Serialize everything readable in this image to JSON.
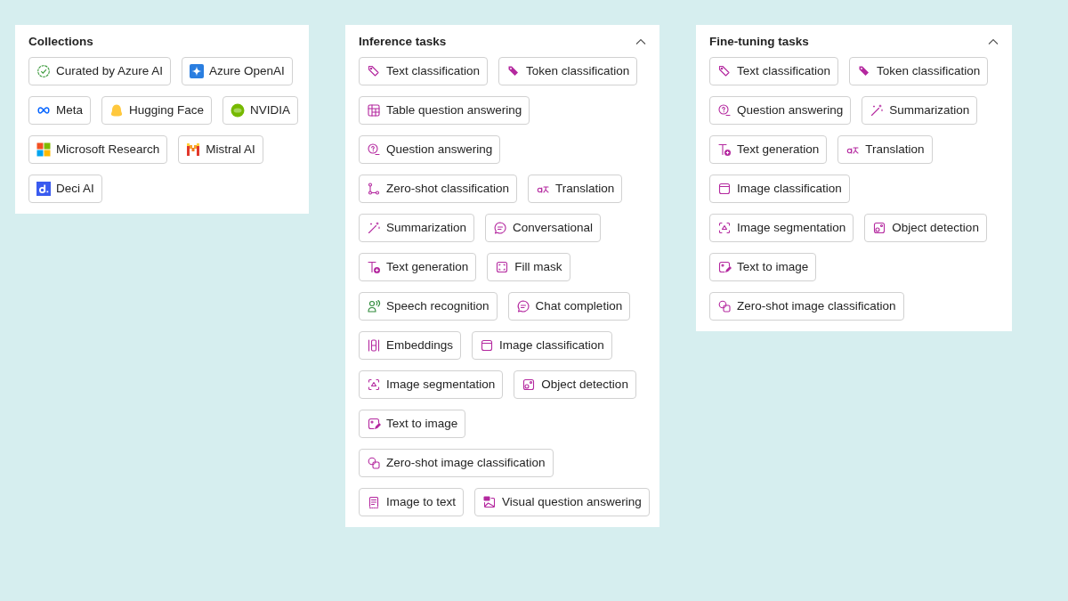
{
  "collections": {
    "title": "Collections",
    "rows": [
      [
        {
          "label": "Curated by Azure AI",
          "kind": "verified"
        },
        {
          "label": "Azure OpenAI",
          "kind": "azure-openai"
        }
      ],
      [
        {
          "label": "Meta",
          "kind": "meta"
        },
        {
          "label": "Hugging Face",
          "kind": "hugging-face"
        },
        {
          "label": "NVIDIA",
          "kind": "nvidia"
        }
      ],
      [
        {
          "label": "Microsoft Research",
          "kind": "microsoft"
        },
        {
          "label": "Mistral AI",
          "kind": "mistral"
        }
      ],
      [
        {
          "label": "Deci AI",
          "kind": "deci"
        }
      ]
    ]
  },
  "inference_tasks": {
    "title": "Inference tasks",
    "expanded": true,
    "rows": [
      [
        {
          "label": "Text classification",
          "kind": "tag"
        },
        {
          "label": "Token classification",
          "kind": "tag-filled"
        }
      ],
      [
        {
          "label": "Table question answering",
          "kind": "table"
        }
      ],
      [
        {
          "label": "Question answering",
          "kind": "question"
        }
      ],
      [
        {
          "label": "Zero-shot classification",
          "kind": "branch"
        },
        {
          "label": "Translation",
          "kind": "translate"
        }
      ],
      [
        {
          "label": "Summarization",
          "kind": "wand"
        },
        {
          "label": "Conversational",
          "kind": "chat"
        }
      ],
      [
        {
          "label": "Text generation",
          "kind": "text-plus"
        },
        {
          "label": "Fill mask",
          "kind": "frame"
        }
      ],
      [
        {
          "label": "Speech recognition",
          "kind": "voice"
        },
        {
          "label": "Chat completion",
          "kind": "chat"
        }
      ],
      [
        {
          "label": "Embeddings",
          "kind": "columns"
        },
        {
          "label": "Image classification",
          "kind": "image"
        }
      ],
      [
        {
          "label": "Image segmentation",
          "kind": "segment"
        },
        {
          "label": "Object detection",
          "kind": "detect"
        }
      ],
      [
        {
          "label": "Text to image",
          "kind": "image-edit"
        }
      ],
      [
        {
          "label": "Zero-shot image classification",
          "kind": "shapes"
        }
      ],
      [
        {
          "label": "Image to text",
          "kind": "document"
        },
        {
          "label": "Visual question answering",
          "kind": "image-question"
        }
      ]
    ]
  },
  "fine_tuning_tasks": {
    "title": "Fine-tuning tasks",
    "expanded": true,
    "rows": [
      [
        {
          "label": "Text classification",
          "kind": "tag"
        },
        {
          "label": "Token classification",
          "kind": "tag-filled"
        }
      ],
      [
        {
          "label": "Question answering",
          "kind": "question"
        },
        {
          "label": "Summarization",
          "kind": "wand"
        }
      ],
      [
        {
          "label": "Text generation",
          "kind": "text-plus"
        },
        {
          "label": "Translation",
          "kind": "translate"
        }
      ],
      [
        {
          "label": "Image classification",
          "kind": "image"
        }
      ],
      [
        {
          "label": "Image segmentation",
          "kind": "segment"
        },
        {
          "label": "Object detection",
          "kind": "detect"
        }
      ],
      [
        {
          "label": "Text to image",
          "kind": "image-edit"
        }
      ],
      [
        {
          "label": "Zero-shot image classification",
          "kind": "shapes"
        }
      ]
    ]
  }
}
